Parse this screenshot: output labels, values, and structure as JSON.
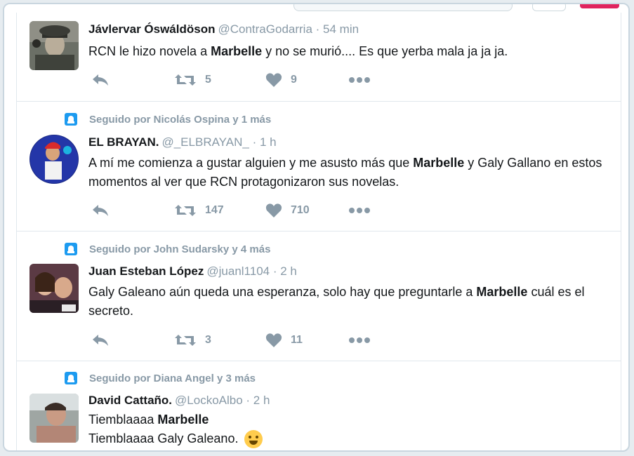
{
  "tweets": [
    {
      "followed_by": "",
      "name": "Jávlervar Óswáldöson",
      "handle": "@ContraGodarria",
      "time": "· 54 min",
      "text_parts": [
        "RCN le hizo novela a ",
        "Marbelle",
        " y no se murió.... Es que yerba mala ja ja ja."
      ],
      "retweets": "5",
      "likes": "9"
    },
    {
      "followed_by": "Seguido por Nicolás Ospina y 1 más",
      "name": "EL BRAYAN.",
      "handle": "@_ELBRAYAN_",
      "time": "· 1 h",
      "text_parts": [
        "A mí me comienza a gustar alguien y me asusto más que ",
        "Marbelle",
        " y Galy Gallano en estos momentos al ver que RCN protagonizaron sus novelas."
      ],
      "retweets": "147",
      "likes": "710"
    },
    {
      "followed_by": "Seguido por John Sudarsky y 4 más",
      "name": "Juan Esteban López",
      "handle": "@juanl1104",
      "time": "· 2 h",
      "text_parts": [
        "Galy Galeano aún queda una esperanza, solo hay que preguntarle a ",
        "Marbelle",
        " cuál es el secreto."
      ],
      "retweets": "3",
      "likes": "11"
    },
    {
      "followed_by": "Seguido por Diana Angel y 3 más",
      "name": "David Cattaño.",
      "handle": "@LockoAlbo",
      "time": "· 2 h",
      "line1_parts": [
        "Tiemblaaaa ",
        "Marbelle"
      ],
      "line2": "Tiemblaaaa Galy Galeano.",
      "emoji": "crying-laughing-emoji"
    }
  ],
  "colors": {
    "accent": "#1d9bf0",
    "muted": "#8899a6",
    "text": "#14171a",
    "border": "#e1e8ed"
  }
}
